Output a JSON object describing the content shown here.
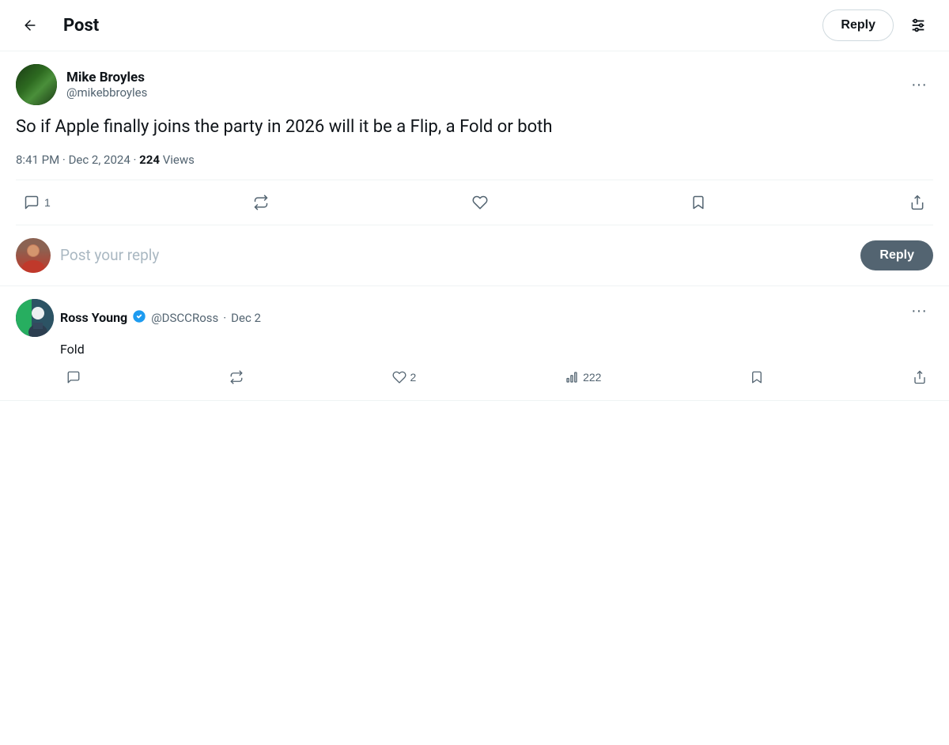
{
  "header": {
    "title": "Post",
    "back_label": "←",
    "reply_button_label": "Reply",
    "settings_title": "Settings"
  },
  "post": {
    "author": {
      "name": "Mike Broyles",
      "handle": "@mikebbroyles"
    },
    "text": "So if Apple finally joins the party in 2026 will it be a Flip, a Fold or both",
    "timestamp": "8:41 PM · Dec 2, 2024",
    "views_count": "224",
    "views_label": "Views"
  },
  "actions": {
    "comment_count": "1",
    "retweet_count": "",
    "like_count": "",
    "bookmark_count": ""
  },
  "reply_input": {
    "placeholder": "Post your reply",
    "button_label": "Reply"
  },
  "replies": [
    {
      "author_name": "Ross Young",
      "author_handle": "@DSCCRoss",
      "date": "Dec 2",
      "verified": true,
      "text": "Fold",
      "like_count": "2",
      "views_count": "222"
    }
  ]
}
